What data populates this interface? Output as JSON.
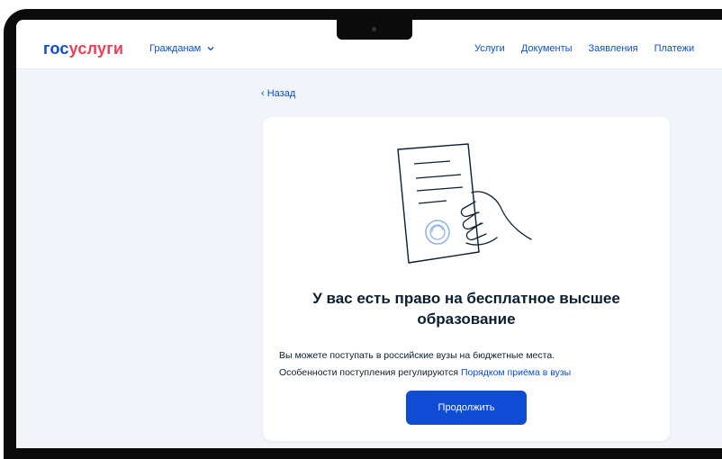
{
  "header": {
    "logo_part1": "гос",
    "logo_part2": "услуги",
    "citizens_label": "Гражданам",
    "nav": [
      "Услуги",
      "Документы",
      "Заявления",
      "Платежи"
    ]
  },
  "back_label": "‹ Назад",
  "card": {
    "title_line1": "У вас есть право на бесплатное высшее",
    "title_line2": "образование",
    "text_line1": "Вы можете поступать в российские вузы на бюджетные места.",
    "text_line2_prefix": "Особенности поступления регулируются ",
    "text_link": "Порядком приёма в вузы",
    "button_label": "Продолжить"
  },
  "colors": {
    "brand_blue": "#0d4cd3",
    "brand_red": "#ee3f58",
    "background": "#f1f5fa",
    "text": "#0b1f33"
  },
  "icons": [
    "chevron-down-icon",
    "document-hand-illustration"
  ]
}
